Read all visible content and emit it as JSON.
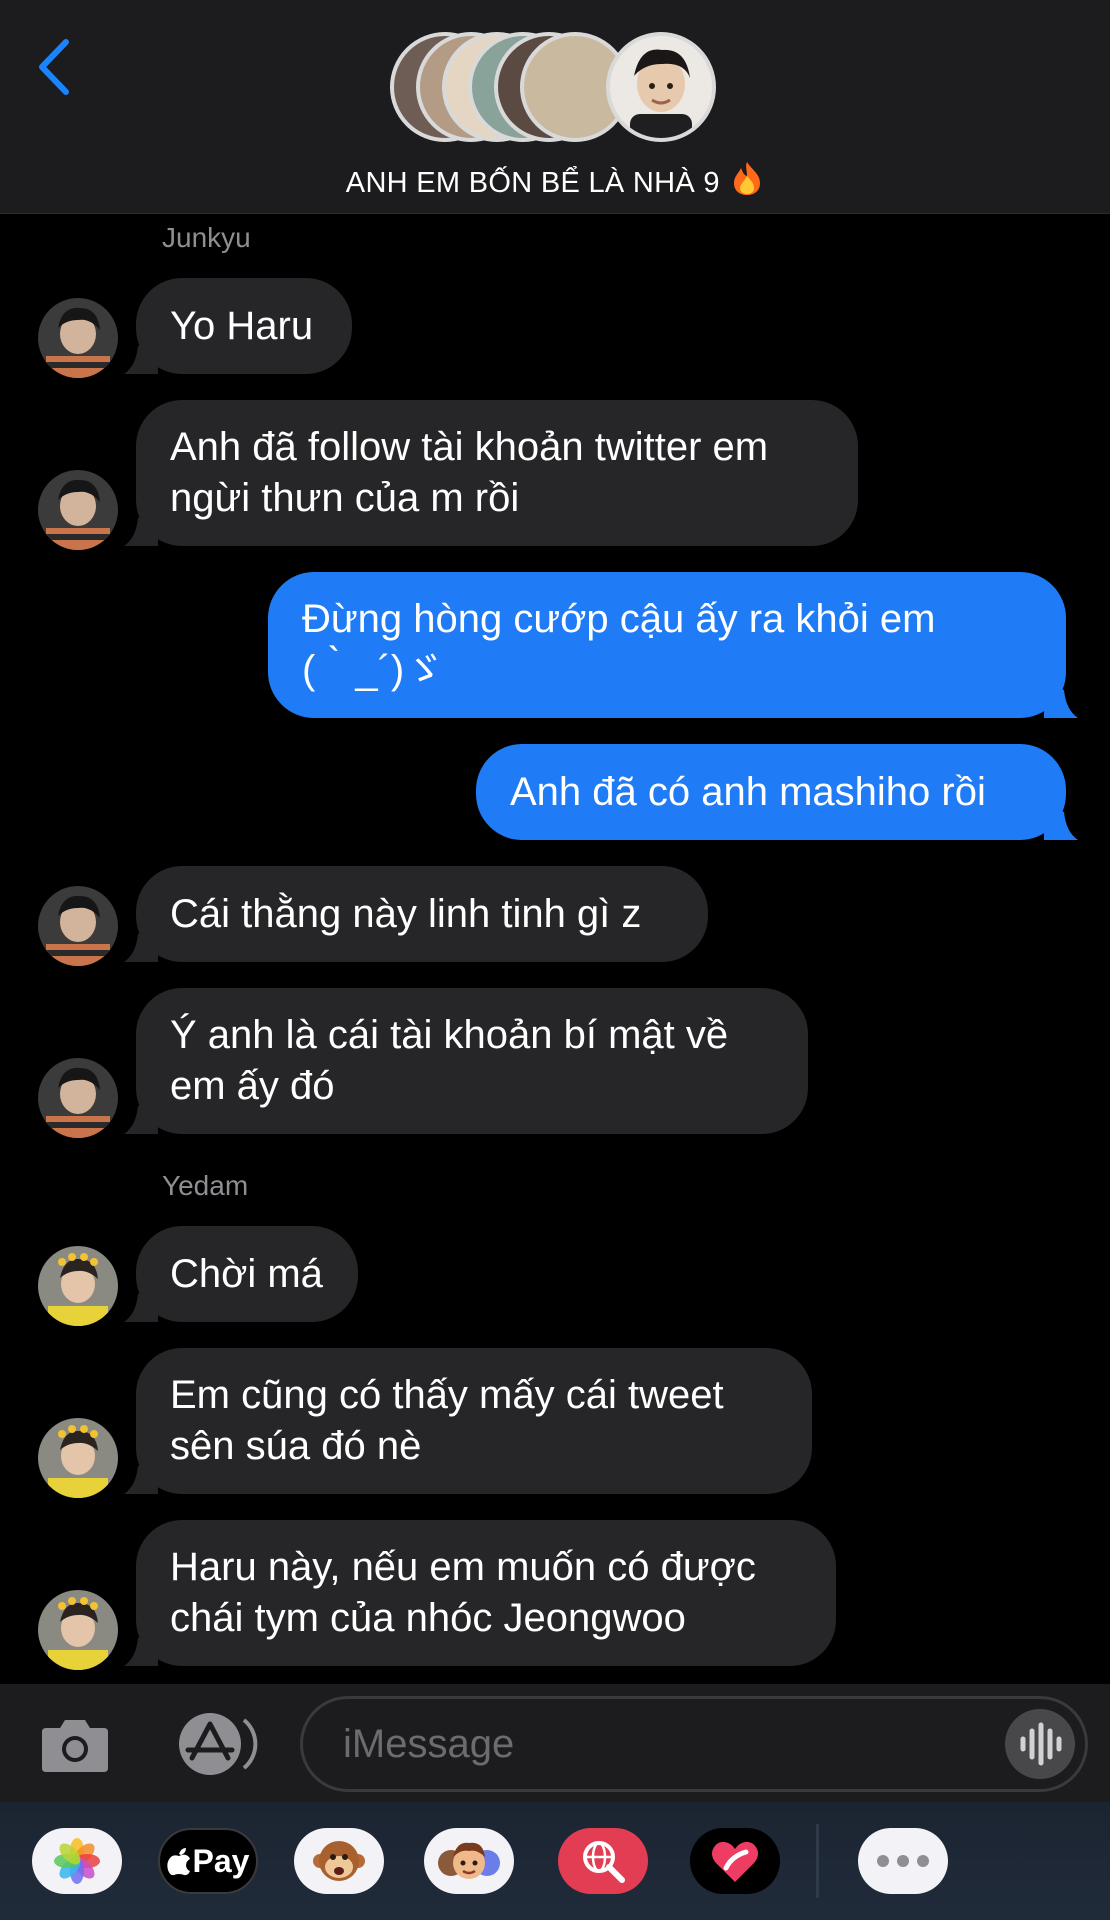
{
  "header": {
    "group_name": "ANH EM BỐN BỂ LÀ NHÀ 9",
    "title_emoji": "fire-icon",
    "back_icon": "chevron-left-icon",
    "member_avatars": [
      "member-1",
      "member-2",
      "member-3",
      "member-4",
      "member-5",
      "member-6",
      "member-7"
    ]
  },
  "thread": {
    "sender_1": "Junkyu",
    "sender_2": "Yedam",
    "messages": [
      {
        "sender": "Junkyu",
        "direction": "incoming",
        "text": "Yo Haru"
      },
      {
        "sender": "Junkyu",
        "direction": "incoming",
        "text": "Anh đã follow tài khoản twitter em\nngừi thưn của m rồi"
      },
      {
        "sender": "me",
        "direction": "outgoing",
        "text": "Đừng hòng cướp cậu ấy ra khỏi em\n(｀_´)ゞ"
      },
      {
        "sender": "me",
        "direction": "outgoing",
        "text": "Anh đã có anh mashiho rồi"
      },
      {
        "sender": "Junkyu",
        "direction": "incoming",
        "text": "Cái thằng này linh tinh gì z"
      },
      {
        "sender": "Junkyu",
        "direction": "incoming",
        "text": "Ý anh là cái tài khoản bí mật về\nem ấy đó"
      },
      {
        "sender": "Yedam",
        "direction": "incoming",
        "text": "Chời má"
      },
      {
        "sender": "Yedam",
        "direction": "incoming",
        "text": "Em cũng có thấy mấy cái tweet\nsên súa đó nè"
      },
      {
        "sender": "Yedam",
        "direction": "incoming",
        "text": "Haru này, nếu em muốn có được\nchái tym của nhóc Jeongwoo"
      }
    ]
  },
  "input_bar": {
    "placeholder": "iMessage",
    "value": "",
    "camera_icon": "camera-icon",
    "apps_icon": "app-store-icon",
    "audio_icon": "audio-waveform-icon"
  },
  "app_drawer": {
    "apple_pay_label": "Pay",
    "items": [
      "photos-icon",
      "apple-pay-icon",
      "animoji-icon",
      "memoji-icon",
      "images-search-icon",
      "digital-touch-icon",
      "more-icon"
    ]
  },
  "colors": {
    "outgoing_bubble": "#1f7cf6",
    "incoming_bubble": "#262628",
    "accent": "#1a84ff",
    "background": "#000000"
  }
}
